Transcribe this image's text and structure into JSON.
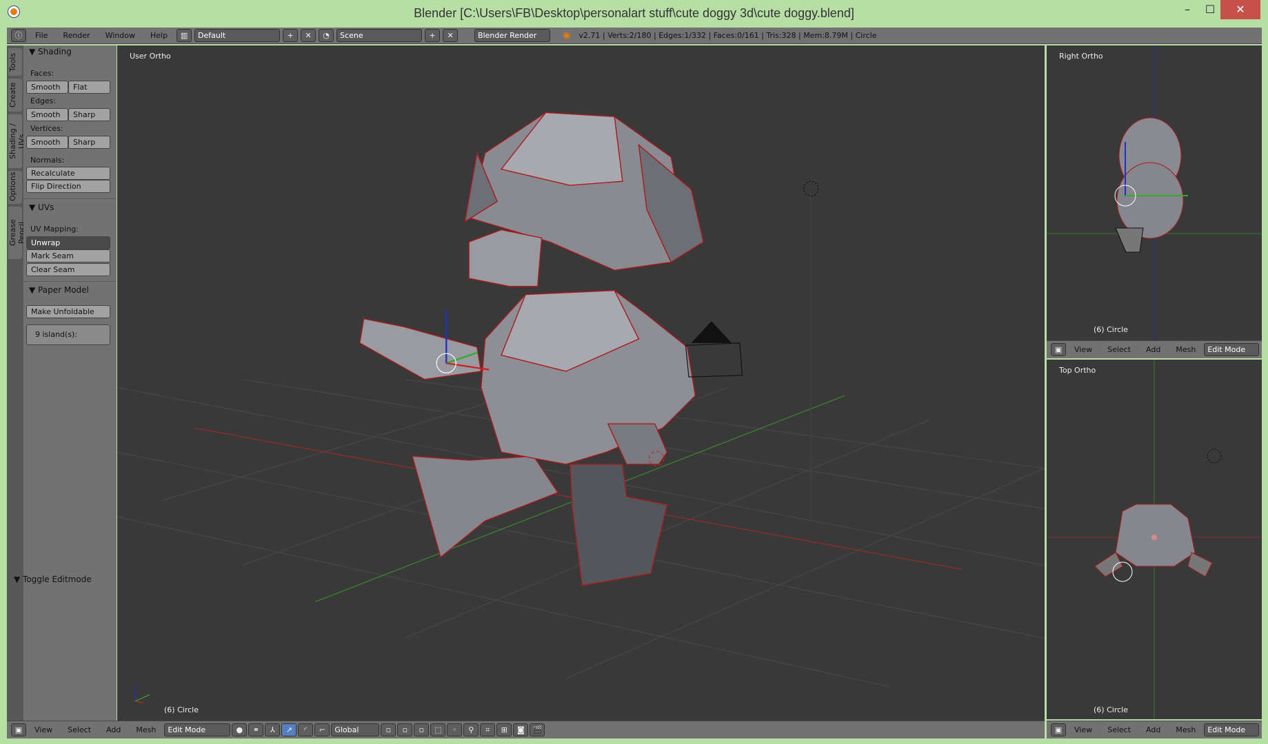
{
  "window": {
    "title": "Blender [C:\\Users\\FB\\Desktop\\personalart stuff\\cute doggy 3d\\cute doggy.blend]",
    "minimize": "–",
    "maximize": "☐",
    "close": "✕"
  },
  "topbar": {
    "menus": [
      "File",
      "Render",
      "Window",
      "Help"
    ],
    "layout": "Default",
    "scene": "Scene",
    "engine": "Blender Render",
    "stats": "v2.71 | Verts:2/180 | Edges:1/332 | Faces:0/161 | Tris:328 | Mem:8.79M | Circle"
  },
  "tabs": [
    "Tools",
    "Create",
    "Shading / UVs",
    "Options",
    "Grease Pencil"
  ],
  "toolpanel": {
    "shading": {
      "title": "▼ Shading",
      "faces": "Faces:",
      "edges": "Edges:",
      "vertices": "Vertices:",
      "normals": "Normals:",
      "smooth": "Smooth",
      "flat": "Flat",
      "sharp": "Sharp",
      "recalculate": "Recalculate",
      "flip": "Flip Direction"
    },
    "uvs": {
      "title": "▼ UVs",
      "mapping": "UV Mapping:",
      "unwrap": "Unwrap",
      "mark_seam": "Mark Seam",
      "clear_seam": "Clear Seam"
    },
    "paper": {
      "title": "▼ Paper Model",
      "make": "Make Unfoldable",
      "islands": "9 island(s):"
    },
    "toggle": "▼ Toggle Editmode"
  },
  "viewport": {
    "label": "User Ortho",
    "object": "(6) Circle"
  },
  "right_view": {
    "label": "Right Ortho",
    "object": "(6) Circle"
  },
  "top_view": {
    "label": "Top Ortho",
    "object": "(6) Circle"
  },
  "header": {
    "menus": [
      "View",
      "Select",
      "Add",
      "Mesh"
    ],
    "mode": "Edit Mode",
    "orientation": "Global"
  },
  "colors": {
    "frame": "#b7dfa5",
    "mesh_edge": "#aa1a1a",
    "x_axis": "#9a2a2a",
    "y_axis": "#3a8a2a",
    "z_axis": "#2030c0"
  }
}
